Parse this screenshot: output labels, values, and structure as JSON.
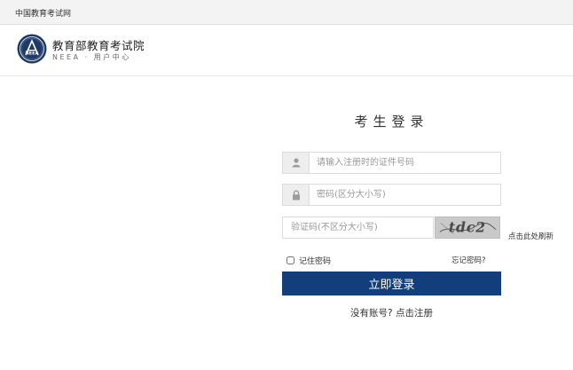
{
  "topbar": {
    "site_link": "中国教育考试网"
  },
  "header": {
    "brand_name": "教育部教育考试院",
    "brand_sub": "NEEA · 用户中心",
    "emblem_text": "NEEA",
    "emblem_icon": "neea-emblem-icon"
  },
  "login": {
    "title": "考生登录",
    "id_placeholder": "请输入注册时的证件号码",
    "id_value": "",
    "id_icon": "user-icon",
    "password_placeholder": "密码(区分大小写)",
    "password_value": "",
    "password_icon": "lock-icon",
    "captcha_placeholder": "验证码(不区分大小写)",
    "captcha_value": "",
    "captcha_text": "tdc2",
    "refresh_label": "点击此处刷新",
    "remember_label": "记住密码",
    "remember_checked": false,
    "forgot_label": "忘记密码?",
    "submit_label": "立即登录",
    "register_prefix": "没有账号?",
    "register_link": "点击注册"
  },
  "colors": {
    "primary_button": "#123f7b",
    "emblem": "#1f3a66",
    "topbar_bg": "#f3f3f3"
  }
}
